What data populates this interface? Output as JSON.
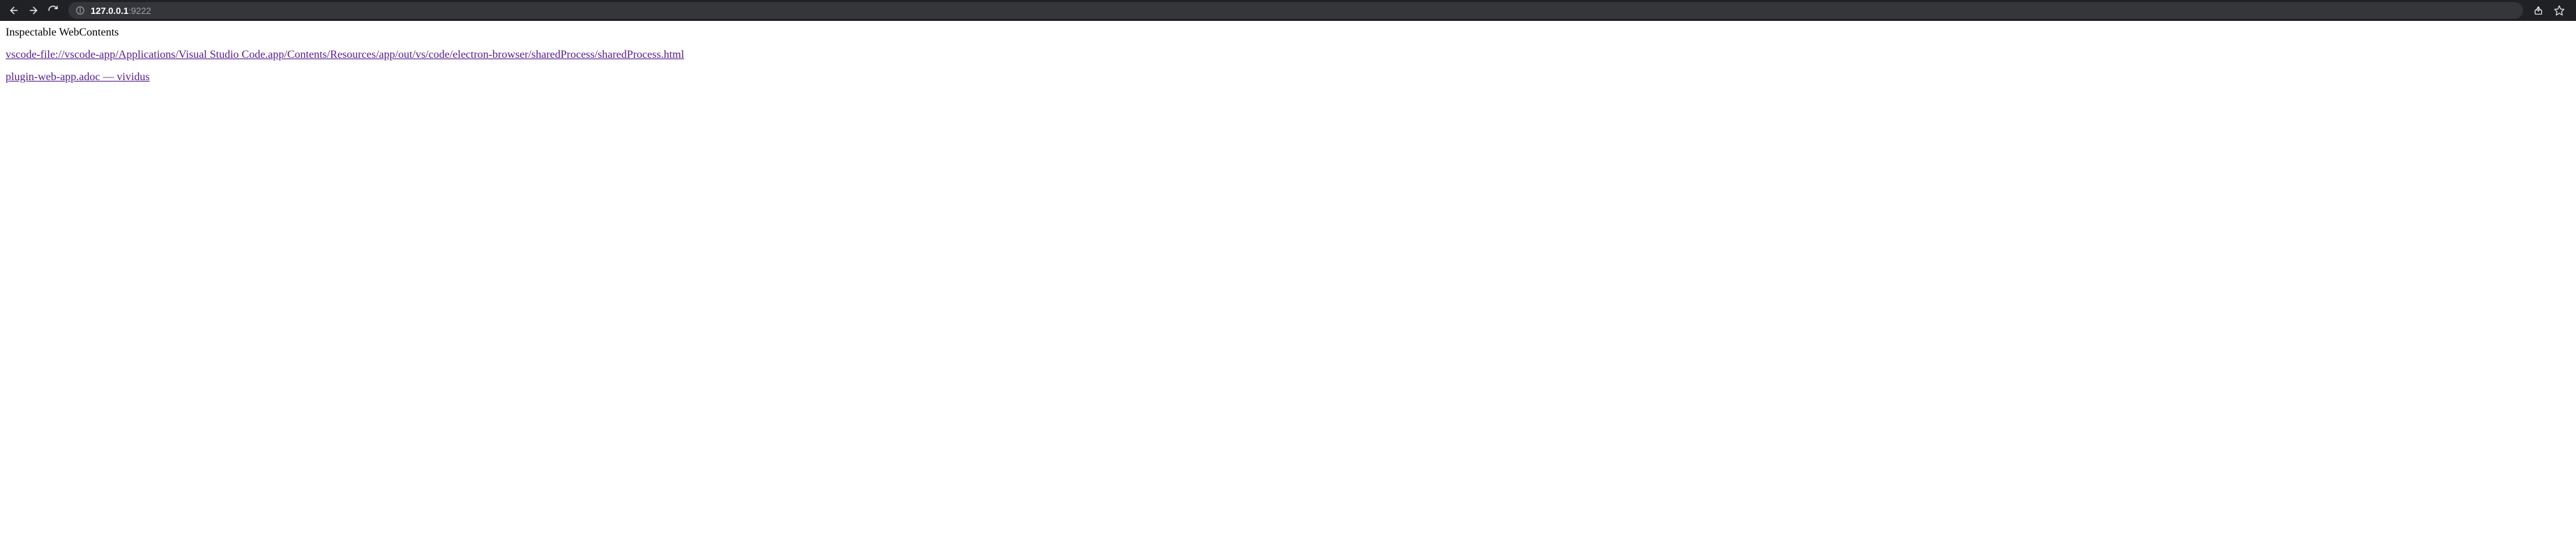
{
  "toolbar": {
    "url_host": "127.0.0.1",
    "url_port": ":9222"
  },
  "page": {
    "heading": "Inspectable WebContents",
    "links": [
      "vscode-file://vscode-app/Applications/Visual Studio Code.app/Contents/Resources/app/out/vs/code/electron-browser/sharedProcess/sharedProcess.html",
      "plugin-web-app.adoc — vividus"
    ]
  }
}
